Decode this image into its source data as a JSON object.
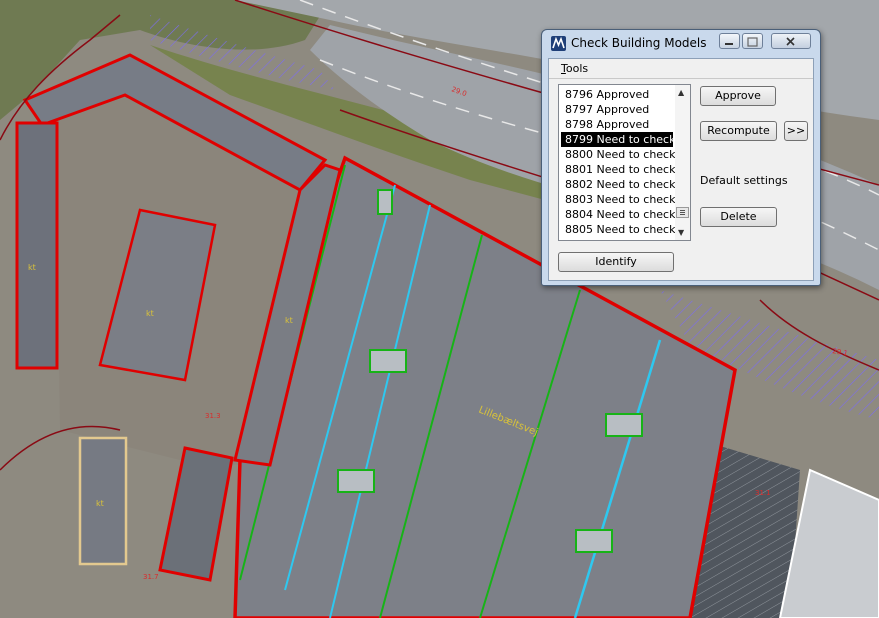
{
  "window": {
    "title": "Check Building Models",
    "menu": {
      "tools_label": "Tools"
    },
    "list": {
      "items": [
        {
          "id": "8796",
          "status": "Approved"
        },
        {
          "id": "8797",
          "status": "Approved"
        },
        {
          "id": "8798",
          "status": "Approved"
        },
        {
          "id": "8799",
          "status": "Need to check"
        },
        {
          "id": "8800",
          "status": "Need to check"
        },
        {
          "id": "8801",
          "status": "Need to check"
        },
        {
          "id": "8802",
          "status": "Need to check"
        },
        {
          "id": "8803",
          "status": "Need to check"
        },
        {
          "id": "8804",
          "status": "Need to check"
        },
        {
          "id": "8805",
          "status": "Need to check"
        }
      ],
      "item_labels": [
        "8796 Approved",
        "8797 Approved",
        "8798 Approved",
        "8799 Need to check",
        "8800 Need to check",
        "8801 Need to check",
        "8802 Need to check",
        "8803 Need to check",
        "8804 Need to check",
        "8805 Need to check"
      ],
      "selected_index": 3
    },
    "buttons": {
      "approve": "Approve",
      "recompute": "Recompute",
      "more": ">>",
      "delete": "Delete",
      "identify": "Identify"
    },
    "default_settings_label": "Default settings"
  },
  "map": {
    "labels": [
      "29.0",
      "31.3",
      "31.1",
      "31.7",
      "29.1",
      "kt",
      "kt",
      "kt",
      "kt",
      "Lillebæltsvej"
    ]
  },
  "colors": {
    "title_bar": "#c9d9ec",
    "selection": "#000000",
    "building_outline": "#e00000",
    "approved_outline": "#17b317",
    "ridge_line": "#2ec8f0",
    "parcel_line": "#8a0a14",
    "hatch": "#7c6cf0"
  },
  "icons": {
    "app": "app-logo-icon",
    "minimize": "minimize-icon",
    "maximize": "maximize-icon",
    "close": "close-icon",
    "scroll_up": "scroll-up-arrow-icon",
    "scroll_down": "scroll-down-arrow-icon"
  }
}
